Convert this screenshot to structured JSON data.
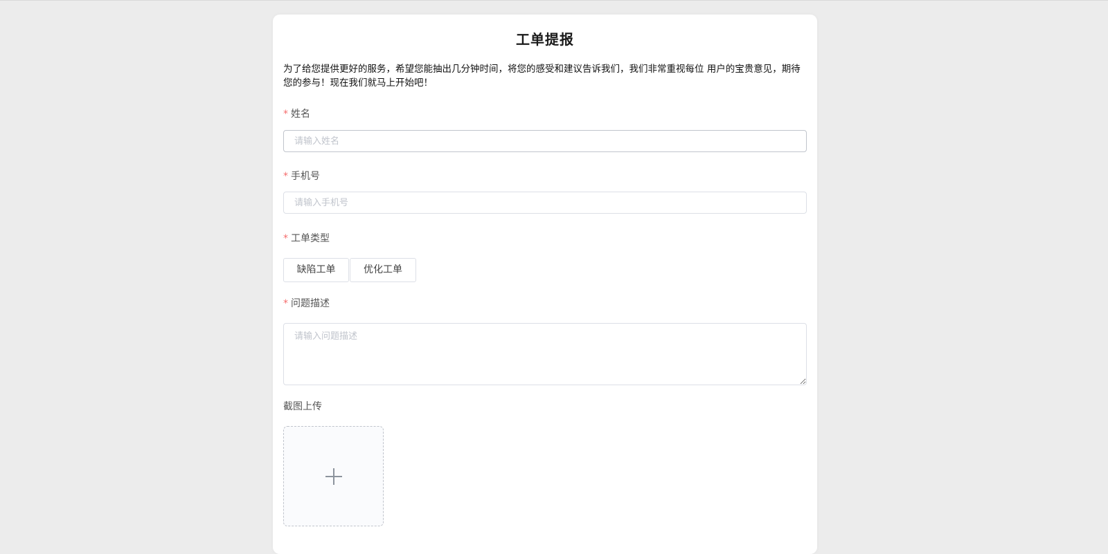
{
  "form": {
    "title": "工单提报",
    "intro": "为了给您提供更好的服务，希望您能抽出几分钟时间，将您的感受和建议告诉我们，我们非常重视每位 用户的宝贵意见，期待您的参与！现在我们就马上开始吧！",
    "required_mark": "*",
    "name": {
      "label": "姓名",
      "value": "",
      "placeholder": "请输入姓名"
    },
    "phone": {
      "label": "手机号",
      "value": "",
      "placeholder": "请输入手机号"
    },
    "ticket_type": {
      "label": "工单类型",
      "options": [
        "缺陷工单",
        "优化工单"
      ]
    },
    "description": {
      "label": "问题描述",
      "value": "",
      "placeholder": "请输入问题描述"
    },
    "screenshot": {
      "label": "截图上传",
      "icon": "plus-icon"
    }
  },
  "colors": {
    "background": "#ececec",
    "card": "#ffffff",
    "required": "#f56c6c",
    "border": "#dcdfe6",
    "placeholder": "#c0c4cc"
  }
}
